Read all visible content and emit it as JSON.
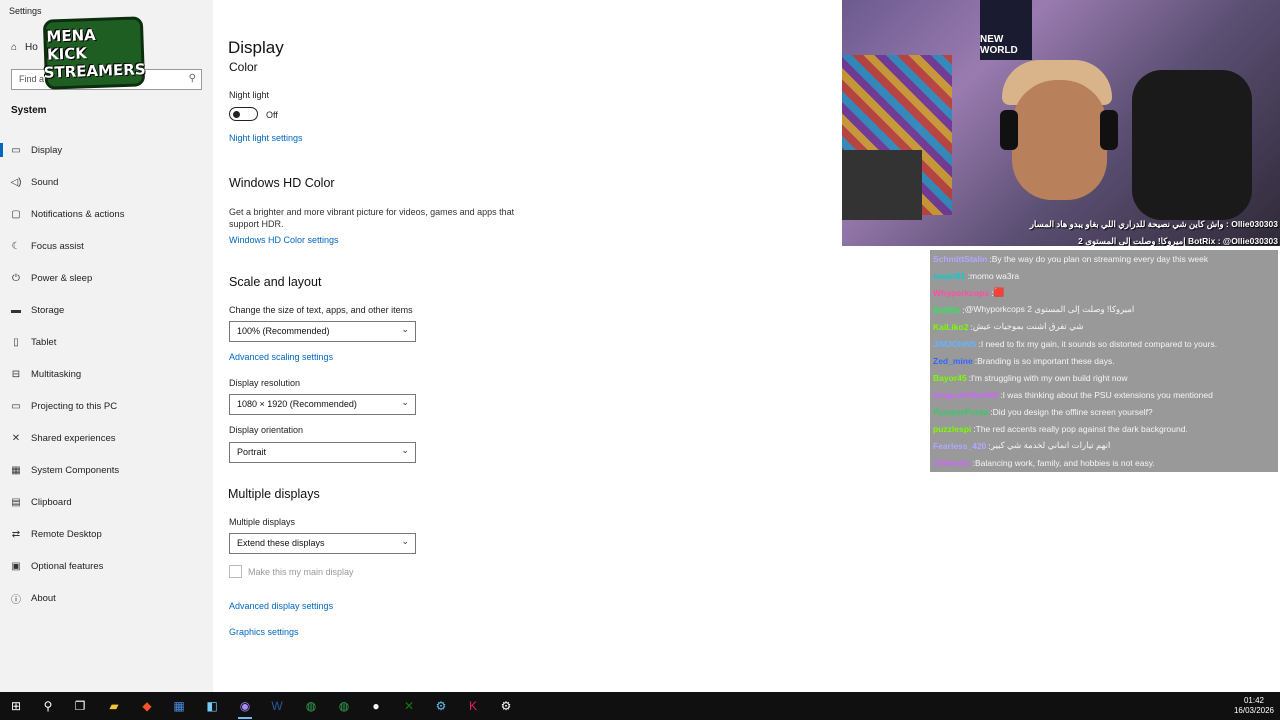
{
  "window": {
    "app_title": "Settings"
  },
  "sidebar": {
    "home_label": "Ho",
    "search_placeholder": "Find a setting",
    "section_label": "System",
    "items": [
      {
        "icon": "monitor-icon",
        "glyph": "▭",
        "label": "Display",
        "active": true
      },
      {
        "icon": "speaker-icon",
        "glyph": "◁)",
        "label": "Sound"
      },
      {
        "icon": "notification-icon",
        "glyph": "▢",
        "label": "Notifications & actions"
      },
      {
        "icon": "focus-icon",
        "glyph": "☾",
        "label": "Focus assist"
      },
      {
        "icon": "power-icon",
        "glyph": "⏻",
        "label": "Power & sleep"
      },
      {
        "icon": "storage-icon",
        "glyph": "▬",
        "label": "Storage"
      },
      {
        "icon": "tablet-icon",
        "glyph": "▯",
        "label": "Tablet"
      },
      {
        "icon": "multitasking-icon",
        "glyph": "⊟",
        "label": "Multitasking"
      },
      {
        "icon": "projecting-icon",
        "glyph": "▭",
        "label": "Projecting to this PC"
      },
      {
        "icon": "shared-icon",
        "glyph": "✕",
        "label": "Shared experiences"
      },
      {
        "icon": "components-icon",
        "glyph": "▦",
        "label": "System Components"
      },
      {
        "icon": "clipboard-icon",
        "glyph": "▤",
        "label": "Clipboard"
      },
      {
        "icon": "remote-desktop-icon",
        "glyph": "⇄",
        "label": "Remote Desktop"
      },
      {
        "icon": "optional-features-icon",
        "glyph": "▣",
        "label": "Optional features"
      },
      {
        "icon": "about-icon",
        "glyph": "ⓘ",
        "label": "About"
      }
    ]
  },
  "logo": {
    "line1": "MENA KICK",
    "line2": "STREAMERS"
  },
  "main": {
    "title": "Display",
    "color_heading": "Color",
    "night_light_label": "Night light",
    "night_light_state": "Off",
    "night_light_link": "Night light settings",
    "hd_heading": "Windows HD Color",
    "hd_desc": "Get a brighter and more vibrant picture for videos, games and apps that support HDR.",
    "hd_link": "Windows HD Color settings",
    "scale_heading": "Scale and layout",
    "scale_label": "Change the size of text, apps, and other items",
    "scale_value": "100% (Recommended)",
    "scale_link": "Advanced scaling settings",
    "resolution_label": "Display resolution",
    "resolution_value": "1080 × 1920 (Recommended)",
    "orientation_label": "Display orientation",
    "orientation_value": "Portrait",
    "multi_heading": "Multiple displays",
    "multi_label": "Multiple displays",
    "multi_value": "Extend these displays",
    "main_display_label": "Make this my main display",
    "advanced_link": "Advanced display settings",
    "graphics_link": "Graphics settings"
  },
  "webcam": {
    "poster_text": "NEW WORLD",
    "overlay_1": "Ollie030303 : واش كاين شي نصيحة للدراري اللي بغاو يبدو هاد المسار",
    "overlay_2": "BotRix : @Ollie030303 إميروكا! وصلت إلى المستوى 2"
  },
  "chat": [
    {
      "name": "SchmittStalin",
      "color": "#b0a8ff",
      "msg": "By the way do you plan on streaming every day this week"
    },
    {
      "name": "souiri91",
      "color": "#00d0d0",
      "msg": "momo wa3ra"
    },
    {
      "name": "Whyporkcops",
      "color": "#ff4da6",
      "msg": "🟥"
    },
    {
      "name": "BotRix",
      "color": "#2ee65a",
      "msg": "@Whyporkcops 2 اميروكا! وصلت إلى المستوى"
    },
    {
      "name": "KaiLiko2",
      "color": "#7cfc00",
      "msg": "شي تفرق اشنت بموجيات عيش"
    },
    {
      "name": "JIMJOHNS",
      "color": "#66b3ff",
      "msg": "I need to fix my gain, it sounds so distorted compared to yours."
    },
    {
      "name": "Zed_mine",
      "color": "#3366ff",
      "msg": "Branding is so important these days."
    },
    {
      "name": "Bayor45",
      "color": "#7cfc00",
      "msg": "I'm struggling with my own build right now"
    },
    {
      "name": "DragonKiller960",
      "color": "#cc66ff",
      "msg": "I was thinking about the PSU extensions you mentioned"
    },
    {
      "name": "PumperPunta",
      "color": "#33cc66",
      "msg": "Did you design the offline screen yourself?"
    },
    {
      "name": "puzzlespi",
      "color": "#7cfc00",
      "msg": "The red accents really pop against the dark background."
    },
    {
      "name": "Fearless_420",
      "color": "#b0a8ff",
      "msg": "انهم تيارات انماني لخدمة شي كبير"
    },
    {
      "name": "zVikestro",
      "color": "#cc66ff",
      "msg": "Balancing work, family, and hobbies is not easy."
    }
  ],
  "taskbar": {
    "icons": [
      "start-icon",
      "search-icon",
      "task-view-icon",
      "file-explorer-icon",
      "brave-icon",
      "calendar-icon",
      "app-icon",
      "obs-icon",
      "word-icon",
      "chrome-icon",
      "chrome-icon-2",
      "github-icon",
      "xbox-icon",
      "steam-icon",
      "kick-icon",
      "settings-icon"
    ],
    "time": "01:42",
    "date": "16/03/2026"
  }
}
